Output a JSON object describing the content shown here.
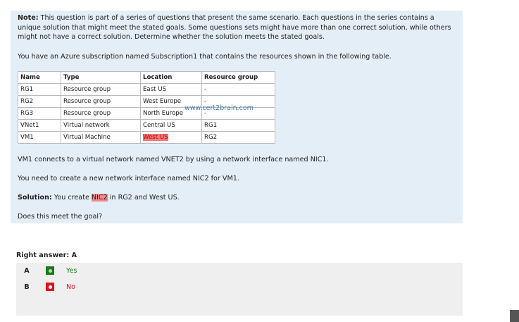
{
  "question": {
    "note_label": "Note:",
    "note_text": " This question is part of a series of questions that present the same scenario. Each questions in the series contains a unique solution that might meet the stated goals. Some questions sets might have more than one correct solution, while others might not have a correct solution. Determine whether the solution meets the stated goals.",
    "intro": "You have an Azure subscription named Subscription1 that contains the resources shown in the following table.",
    "table": {
      "headers": [
        "Name",
        "Type",
        "Location",
        "Resource group"
      ],
      "rows": [
        [
          "RG1",
          "Resource group",
          "East US",
          "-"
        ],
        [
          "RG2",
          "Resource group",
          "West Europe",
          "-"
        ],
        [
          "RG3",
          "Resource group",
          "North Europe",
          "-"
        ],
        [
          "VNet1",
          "Virtual network",
          "Central US",
          "RG1"
        ],
        [
          "VM1",
          "Virtual Machine",
          "West US",
          "RG2"
        ]
      ]
    },
    "watermark": "www.cert2brain.com",
    "p1": "VM1 connects to a virtual network named VNET2 by using a network interface named NIC1.",
    "p2": "You need to create a new network interface named NIC2 for VM1.",
    "solution_label": "Solution:",
    "solution_pre": " You create ",
    "solution_mark": "NIC2",
    "solution_post": " in RG2 and West US.",
    "goal": "Does this meet the goal?"
  },
  "answer": {
    "right_answer": "Right answer: A",
    "options": [
      {
        "letter": "A",
        "text": "Yes",
        "color": "#1a7a1a"
      },
      {
        "letter": "B",
        "text": "No",
        "color": "#e0141e"
      }
    ]
  }
}
